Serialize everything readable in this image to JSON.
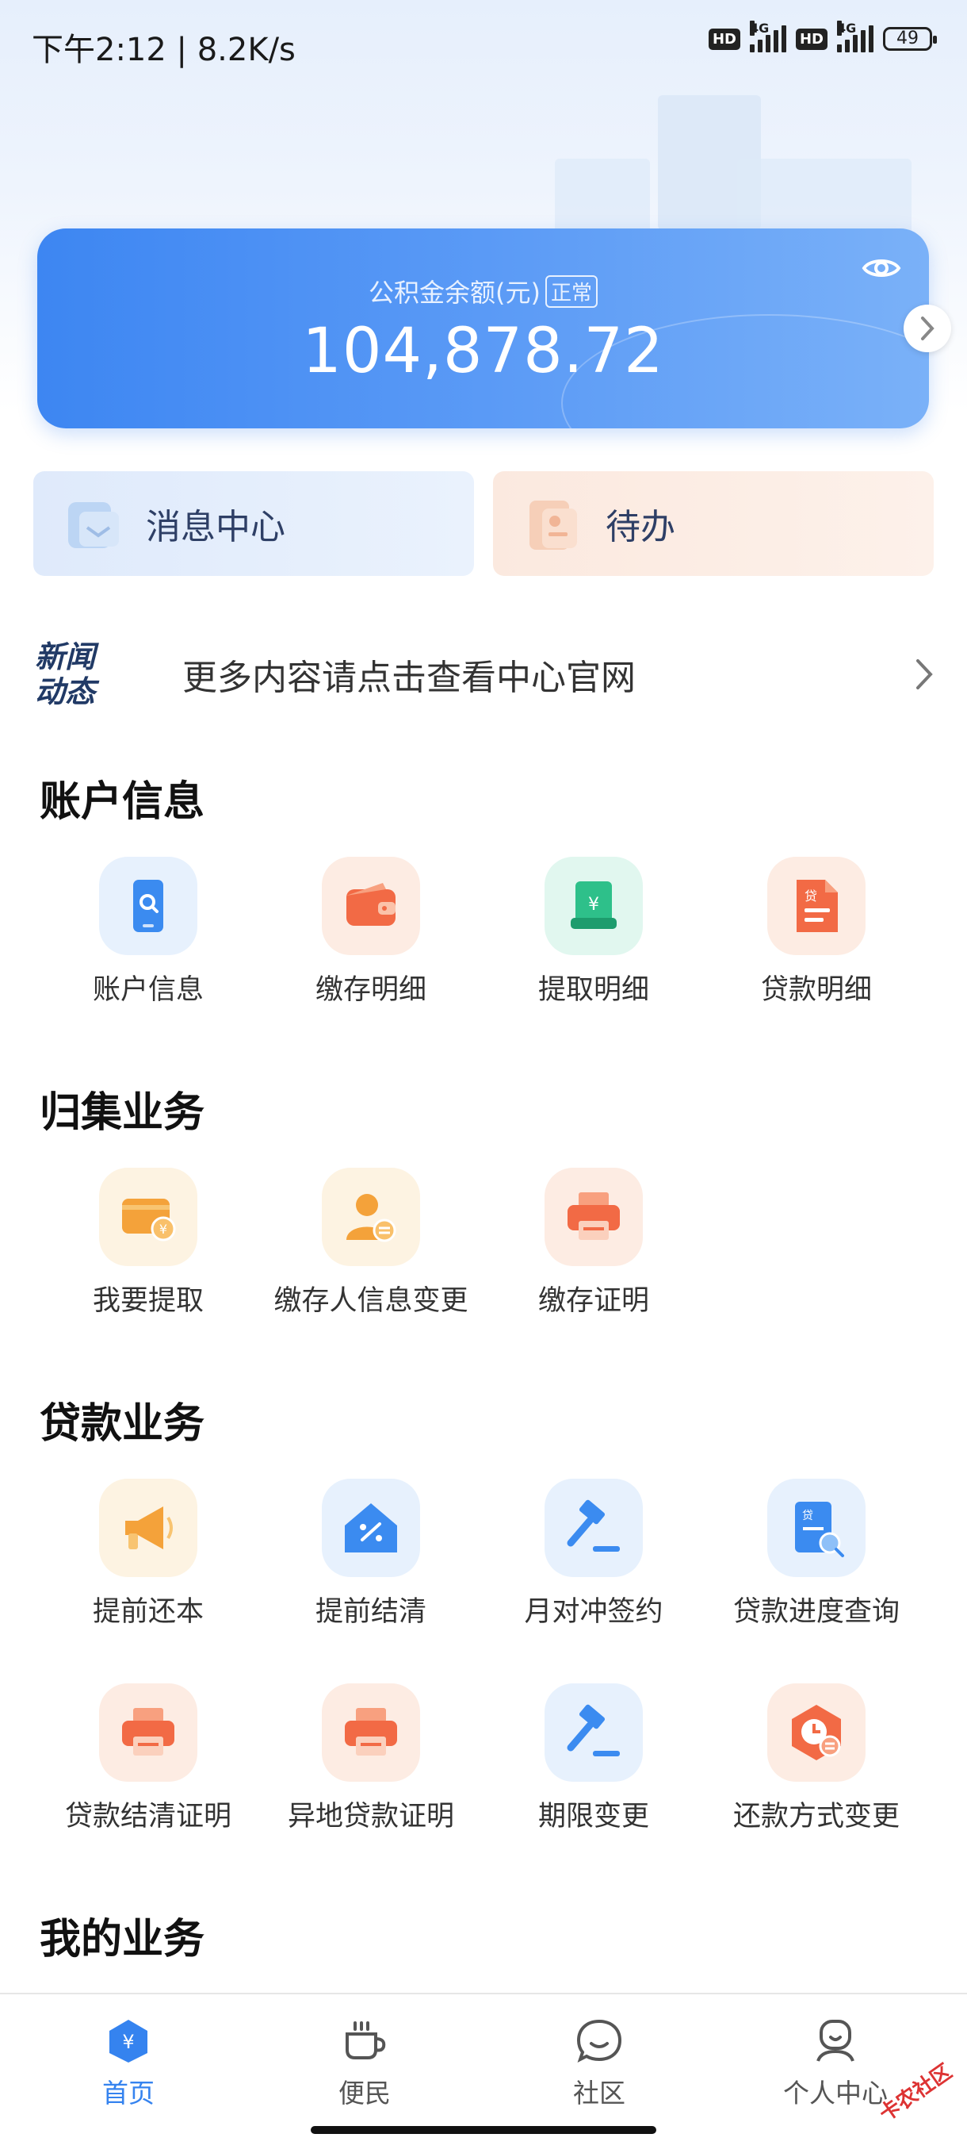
{
  "status_bar": {
    "time": "下午2:12 | 8.2K/s",
    "hd1": "HD",
    "net1": "4G",
    "hd2": "HD",
    "net2": "4G",
    "battery": "49"
  },
  "balance_card": {
    "label": "公积金余额(元)",
    "status_tag": "正常",
    "amount": "104,878.72",
    "eye_icon": "eye-icon",
    "accent": "#3d86f2"
  },
  "quick_tiles": [
    {
      "label": "消息中心",
      "icon": "message-center-icon"
    },
    {
      "label": "待办",
      "icon": "todo-icon"
    }
  ],
  "news": {
    "logo": "新闻动态",
    "logo_line1": "新闻",
    "logo_line2": "动态",
    "text": "更多内容请点击查看中心官网"
  },
  "sections": {
    "account": {
      "title": "账户信息",
      "items": [
        {
          "label": "账户信息",
          "icon": "phone-search-icon"
        },
        {
          "label": "缴存明细",
          "icon": "wallet-icon"
        },
        {
          "label": "提取明细",
          "icon": "yuan-card-icon"
        },
        {
          "label": "贷款明细",
          "icon": "loan-document-icon"
        }
      ]
    },
    "collection": {
      "title": "归集业务",
      "items": [
        {
          "label": "我要提取",
          "icon": "wallet-yuan-icon"
        },
        {
          "label": "缴存人信息变更",
          "icon": "user-exchange-icon"
        },
        {
          "label": "缴存证明",
          "icon": "printer-icon"
        }
      ]
    },
    "loan": {
      "title": "贷款业务",
      "items": [
        {
          "label": "提前还本",
          "icon": "megaphone-icon"
        },
        {
          "label": "提前结清",
          "icon": "house-percent-icon"
        },
        {
          "label": "月对冲签约",
          "icon": "gavel-icon"
        },
        {
          "label": "贷款进度查询",
          "icon": "loan-search-icon"
        },
        {
          "label": "贷款结清证明",
          "icon": "printer-icon"
        },
        {
          "label": "异地贷款证明",
          "icon": "printer-icon"
        },
        {
          "label": "期限变更",
          "icon": "gavel-icon"
        },
        {
          "label": "还款方式变更",
          "icon": "clock-exchange-icon"
        }
      ]
    },
    "mine": {
      "title": "我的业务"
    }
  },
  "bottom_nav": [
    {
      "label": "首页",
      "icon": "home-yuan-icon",
      "active": true
    },
    {
      "label": "便民",
      "icon": "cup-icon",
      "active": false
    },
    {
      "label": "社区",
      "icon": "chat-icon",
      "active": false
    },
    {
      "label": "个人中心",
      "icon": "user-icon",
      "active": false
    }
  ],
  "watermark": "卡农社区",
  "colors": {
    "primary": "#3583ef",
    "orange": "#f26a45",
    "green": "#2ec08a",
    "yellow": "#f4a23a"
  }
}
